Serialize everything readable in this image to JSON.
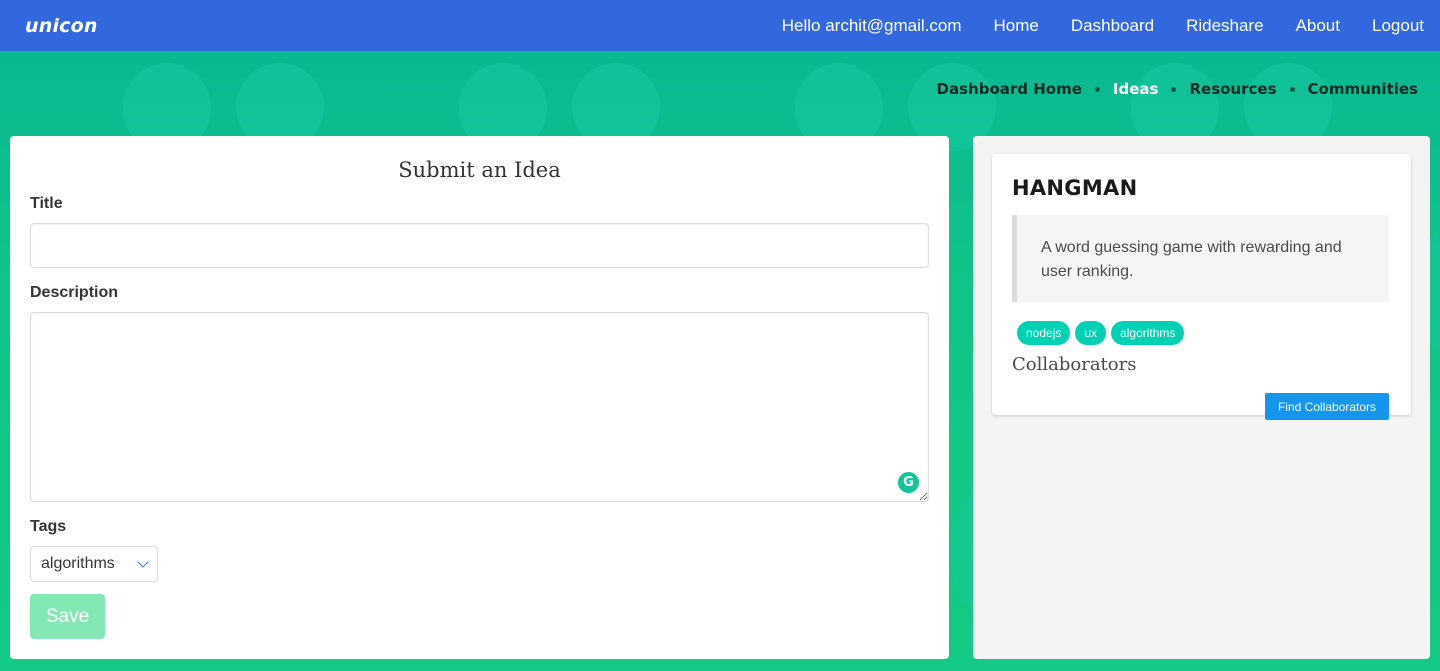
{
  "navbar": {
    "brand": "unicon",
    "greeting": "Hello archit@gmail.com",
    "links": [
      "Home",
      "Dashboard",
      "Rideshare",
      "About",
      "Logout"
    ]
  },
  "subnav": {
    "items": [
      "Dashboard Home",
      "Ideas",
      "Resources",
      "Communities"
    ],
    "active": "Ideas"
  },
  "form": {
    "heading": "Submit an Idea",
    "title_label": "Title",
    "title_value": "",
    "description_label": "Description",
    "description_value": "",
    "tags_label": "Tags",
    "tags_selected": "algorithms",
    "save_label": "Save",
    "grammarly_glyph": "G"
  },
  "idea_card": {
    "title": "HANGMAN",
    "description": "A word guessing game with rewarding and user ranking.",
    "tags": [
      "nodejs",
      "ux",
      "algorithms"
    ],
    "collaborators_label": "Collaborators",
    "find_collaborators_label": "Find Collaborators"
  },
  "colors": {
    "navbar": "#3367de",
    "background": "#0ab88f",
    "tag": "#00d1b2",
    "save_button": "#7ee7b0",
    "find_button": "#1496ed"
  },
  "icons": {
    "select_chevron": "chevron-down-icon",
    "grammarly": "grammarly-icon"
  }
}
